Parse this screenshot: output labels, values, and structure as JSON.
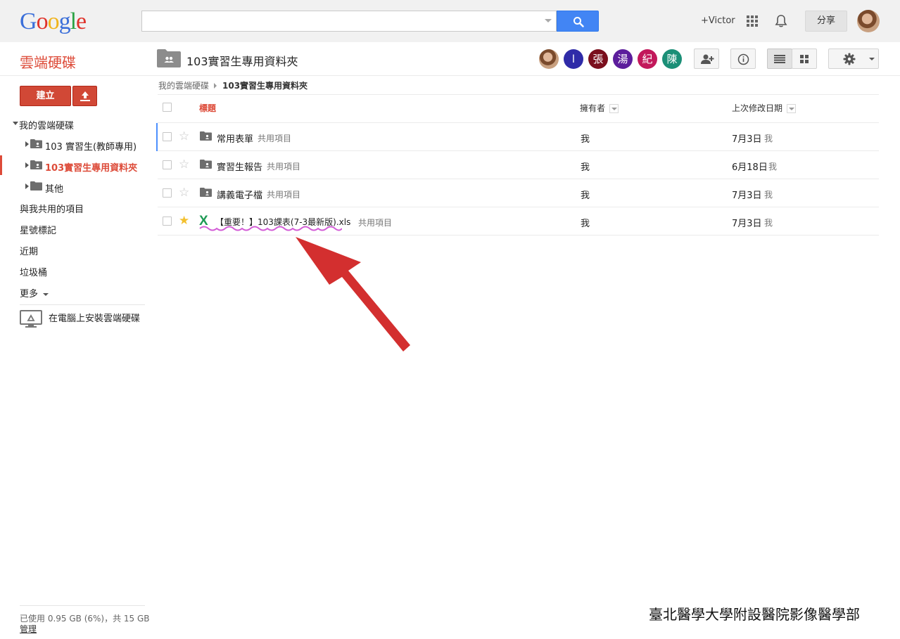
{
  "topbar": {
    "logo_letters": [
      {
        "ch": "G",
        "color": "#3b6fd9"
      },
      {
        "ch": "o",
        "color": "#e0332b"
      },
      {
        "ch": "o",
        "color": "#f0b41c"
      },
      {
        "ch": "g",
        "color": "#3b6fd9"
      },
      {
        "ch": "l",
        "color": "#2aa243"
      },
      {
        "ch": "e",
        "color": "#e0332b"
      }
    ],
    "search_value": "",
    "user_link": "+Victor",
    "share_label": "分享"
  },
  "app": {
    "title": "雲端硬碟",
    "accent": "#dd4b39"
  },
  "folder": {
    "name": "103實習生專用資料夾"
  },
  "collaborators": [
    {
      "initial": "",
      "color": "#8a6a55",
      "is_photo": true
    },
    {
      "initial": "l",
      "color": "#2f2ba8"
    },
    {
      "initial": "張",
      "color": "#7a0f1d"
    },
    {
      "initial": "湯",
      "color": "#5c1d9c"
    },
    {
      "initial": "紀",
      "color": "#c2185b"
    },
    {
      "initial": "陳",
      "color": "#1b8f77"
    }
  ],
  "breadcrumb": {
    "root": "我的雲端硬碟",
    "current": "103實習生專用資料夾"
  },
  "sidebar": {
    "create_label": "建立",
    "my_drive": "我的雲端硬碟",
    "folders": [
      {
        "label": "103 實習生(教師專用)",
        "active": false
      },
      {
        "label": "103實習生專用資料夾",
        "active": true
      },
      {
        "label": "其他",
        "active": false
      }
    ],
    "items": [
      "與我共用的項目",
      "星號標記",
      "近期",
      "垃圾桶"
    ],
    "more_label": "更多",
    "install_label": "在電腦上安裝雲端硬碟",
    "storage_text": "已使用 0.95 GB (6%)，共 15 GB",
    "manage_label": "管理"
  },
  "list": {
    "headers": {
      "title": "標題",
      "owner": "擁有者",
      "modified": "上次修改日期"
    },
    "rows": [
      {
        "name": "常用表單",
        "tag": "共用項目",
        "owner": "我",
        "date": "7月3日",
        "by": "我",
        "starred": false,
        "type": "shared-folder"
      },
      {
        "name": "實習生報告",
        "tag": "共用項目",
        "owner": "我",
        "date": "6月18日",
        "by": "我",
        "starred": false,
        "type": "shared-folder"
      },
      {
        "name": "講義電子檔",
        "tag": "共用項目",
        "owner": "我",
        "date": "7月3日",
        "by": "我",
        "starred": false,
        "type": "shared-folder"
      },
      {
        "name": "【重要！】103課表(7-3最新版).xls",
        "tag": "共用項目",
        "owner": "我",
        "date": "7月3日",
        "by": "我",
        "starred": true,
        "type": "excel-file",
        "icon_letter": "X"
      }
    ]
  },
  "footer_note": "臺北醫學大學附設醫院影像醫學部"
}
